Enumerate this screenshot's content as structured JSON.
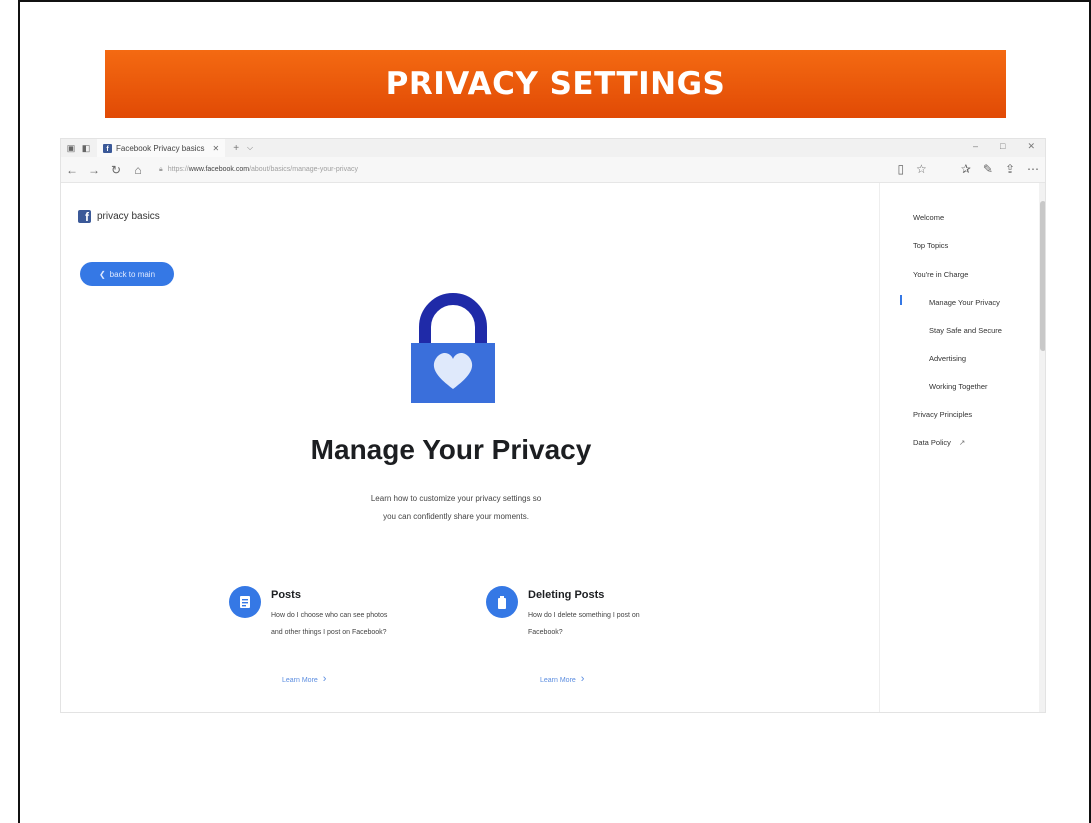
{
  "banner": {
    "title": "PRIVACY SETTINGS"
  },
  "browser": {
    "tab_title": "Facebook Privacy basics",
    "tab_close": "✕",
    "tab_new": "+",
    "tab_dropdown": "⌵",
    "win_min": "–",
    "win_max": "□",
    "win_close": "✕",
    "url_prefix": "https://",
    "url_domain": "www.facebook.com",
    "url_path": "/about/basics/manage-your-privacy"
  },
  "page": {
    "brand_label": "privacy basics",
    "back_label": "back to main",
    "title": "Manage Your Privacy",
    "subtitle_line1": "Learn how to customize your privacy settings so",
    "subtitle_line2": "you can confidently share your moments.",
    "cards": [
      {
        "title": "Posts",
        "desc_line1": "How do I choose who can see photos",
        "desc_line2": "and other things I post on Facebook?",
        "link": "Learn More"
      },
      {
        "title": "Deleting Posts",
        "desc_line1": "How do I delete something I post on",
        "desc_line2": "Facebook?",
        "link": "Learn More"
      }
    ]
  },
  "sidebar": {
    "items": [
      {
        "label": "Welcome"
      },
      {
        "label": "Top Topics"
      },
      {
        "label": "You're in Charge"
      },
      {
        "label": "Manage Your Privacy"
      },
      {
        "label": "Stay Safe and Secure"
      },
      {
        "label": "Advertising"
      },
      {
        "label": "Working Together"
      },
      {
        "label": "Privacy Principles"
      },
      {
        "label": "Data Policy"
      }
    ],
    "external_icon": "↗"
  },
  "colors": {
    "accent": "#3578e5",
    "banner": "#ef5c0b",
    "facebook": "#3b5998"
  }
}
